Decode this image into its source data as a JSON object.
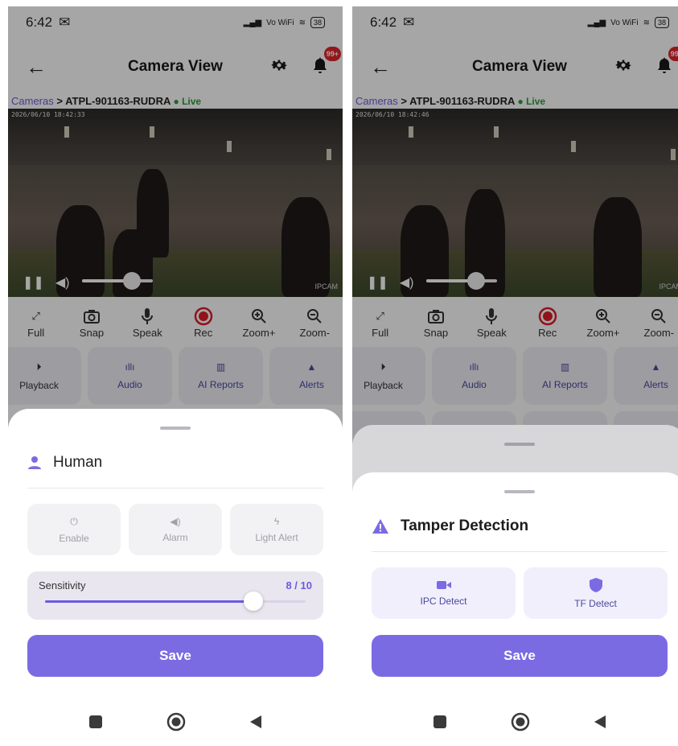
{
  "colors": {
    "accent": "#7a6be3",
    "live": "#2a9d3a",
    "badge": "#e0242a",
    "rec": "#e01c2a"
  },
  "screens": [
    {
      "status": {
        "time": "6:42",
        "mail_icon": "mail-icon",
        "network": "Vo WiFi",
        "battery": "38"
      },
      "appbar": {
        "title": "Camera View",
        "badge": "99+"
      },
      "breadcrumb": {
        "root": "Cameras",
        "separator": ">",
        "camera": "ATPL-901163-RUDRA",
        "live": "● Live"
      },
      "video": {
        "timestamp": "2026/06/10 18:42:33",
        "watermark": "IPCAM",
        "volume": 0.7
      },
      "controls": [
        "Full",
        "Snap",
        "Speak",
        "Rec",
        "Zoom+",
        "Zoom-"
      ],
      "tiles": [
        "Playback",
        "Audio",
        "AI Reports",
        "Alerts"
      ],
      "sheet": {
        "title": "Human",
        "options": [
          "Enable",
          "Alarm",
          "Light Alert"
        ],
        "sensitivity_label": "Sensitivity",
        "sensitivity_value": "8 / 10",
        "sensitivity_fraction": 0.8,
        "save": "Save"
      }
    },
    {
      "status": {
        "time": "6:42",
        "mail_icon": "mail-icon",
        "network": "Vo WiFi",
        "battery": "38"
      },
      "appbar": {
        "title": "Camera View",
        "badge": "99+"
      },
      "breadcrumb": {
        "root": "Cameras",
        "separator": ">",
        "camera": "ATPL-901163-RUDRA",
        "live": "● Live"
      },
      "video": {
        "timestamp": "2026/06/10 18:42:46",
        "watermark": "IPCAM",
        "volume": 0.7
      },
      "controls": [
        "Full",
        "Snap",
        "Speak",
        "Rec",
        "Zoom+",
        "Zoom-"
      ],
      "tiles": [
        "Playback",
        "Audio",
        "AI Reports",
        "Alerts"
      ],
      "sheet": {
        "title": "Tamper Detection",
        "options": [
          "IPC Detect",
          "TF Detect"
        ],
        "save": "Save"
      }
    }
  ]
}
